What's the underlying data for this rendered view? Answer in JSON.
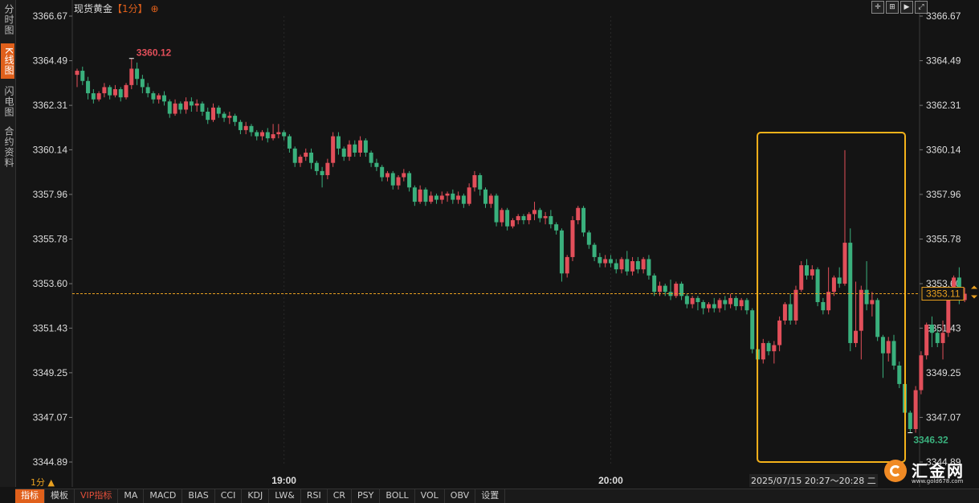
{
  "sidebar": {
    "tabs": [
      {
        "label": "分时图",
        "active": false
      },
      {
        "label": "K线图",
        "active": true
      },
      {
        "label": "闪电图",
        "active": false
      },
      {
        "label": "合约资料",
        "active": false
      }
    ]
  },
  "header": {
    "title": "现货黄金",
    "period": "【1分】",
    "add_symbol": "⊕"
  },
  "toolbar_icons": [
    "crosshair-icon",
    "zoom-icon",
    "play-icon",
    "fit-icon"
  ],
  "period_label": "1分 ▲",
  "range_label": "2025/07/15 20:27～20:28 二",
  "bottom_tabs": [
    {
      "label": "指标",
      "active": true
    },
    {
      "label": "模板"
    },
    {
      "label": "VIP指标",
      "vip": true
    },
    {
      "label": "MA"
    },
    {
      "label": "MACD"
    },
    {
      "label": "BIAS"
    },
    {
      "label": "CCI"
    },
    {
      "label": "KDJ"
    },
    {
      "label": "LW&"
    },
    {
      "label": "RSI"
    },
    {
      "label": "CR"
    },
    {
      "label": "PSY"
    },
    {
      "label": "BOLL"
    },
    {
      "label": "VOL"
    },
    {
      "label": "OBV"
    },
    {
      "label": "设置"
    }
  ],
  "logo": {
    "name": "汇金网",
    "url": "www.gold678.com"
  },
  "colors": {
    "up": "#e24f5a",
    "down": "#3ab07d",
    "accent": "#e0601b",
    "highlight": "#f5b21a",
    "background": "#141414"
  },
  "chart_data": {
    "type": "candlestick",
    "y_ticks": [
      3366.67,
      3364.49,
      3362.31,
      3360.14,
      3357.96,
      3355.78,
      3353.6,
      3351.43,
      3349.25,
      3347.07,
      3344.89
    ],
    "y_tick_labels": [
      "3366.67",
      "3364.49",
      "3362.31",
      "3360.14",
      "3357.96",
      "3355.78",
      "3353.60",
      "3351.43",
      "3349.25",
      "3347.07",
      "3344.89"
    ],
    "ylim": [
      3344.89,
      3366.67
    ],
    "x_tick_labels": [
      {
        "label": "19:00",
        "index": 38
      },
      {
        "label": "20:00",
        "index": 98
      }
    ],
    "current_price": 3353.11,
    "current_price_label": "3353.11",
    "high_label": "3360.12",
    "low_label": "3346.32",
    "highlight_range": [
      127,
      150
    ],
    "candles": [
      [
        3363.8,
        3364.0,
        3363.2,
        3364.1
      ],
      [
        3364.0,
        3363.5,
        3363.3,
        3364.2
      ],
      [
        3363.5,
        3362.9,
        3362.6,
        3363.7
      ],
      [
        3362.9,
        3362.6,
        3362.4,
        3363.1
      ],
      [
        3362.6,
        3362.9,
        3362.5,
        3363.0
      ],
      [
        3362.9,
        3363.2,
        3362.7,
        3363.4
      ],
      [
        3363.2,
        3362.8,
        3362.6,
        3363.3
      ],
      [
        3362.8,
        3363.1,
        3362.7,
        3363.3
      ],
      [
        3363.1,
        3362.7,
        3362.5,
        3363.2
      ],
      [
        3362.7,
        3363.3,
        3362.6,
        3363.4
      ],
      [
        3363.3,
        3364.1,
        3363.1,
        3364.6
      ],
      [
        3364.1,
        3363.6,
        3363.3,
        3364.4
      ],
      [
        3363.6,
        3363.2,
        3362.9,
        3363.8
      ],
      [
        3363.2,
        3362.9,
        3362.7,
        3363.4
      ],
      [
        3362.9,
        3362.6,
        3362.4,
        3363.0
      ],
      [
        3362.6,
        3362.8,
        3362.4,
        3362.9
      ],
      [
        3362.8,
        3362.5,
        3362.3,
        3363.0
      ],
      [
        3362.5,
        3361.9,
        3361.7,
        3362.6
      ],
      [
        3361.9,
        3362.4,
        3361.8,
        3362.6
      ],
      [
        3362.4,
        3362.1,
        3361.9,
        3362.5
      ],
      [
        3362.1,
        3362.5,
        3361.9,
        3362.7
      ],
      [
        3362.5,
        3362.3,
        3362.0,
        3362.7
      ],
      [
        3362.3,
        3362.4,
        3362.0,
        3362.6
      ],
      [
        3362.4,
        3362.0,
        3361.8,
        3362.5
      ],
      [
        3362.0,
        3361.6,
        3361.4,
        3362.2
      ],
      [
        3361.6,
        3362.2,
        3361.5,
        3362.4
      ],
      [
        3362.2,
        3361.9,
        3361.7,
        3362.3
      ],
      [
        3361.9,
        3361.7,
        3361.5,
        3362.0
      ],
      [
        3361.7,
        3361.8,
        3361.4,
        3362.0
      ],
      [
        3361.8,
        3361.5,
        3361.3,
        3361.9
      ],
      [
        3361.5,
        3361.1,
        3360.9,
        3361.6
      ],
      [
        3361.1,
        3361.3,
        3360.9,
        3361.5
      ],
      [
        3361.3,
        3361.0,
        3360.8,
        3361.4
      ],
      [
        3361.0,
        3360.8,
        3360.6,
        3361.1
      ],
      [
        3360.8,
        3361.0,
        3360.6,
        3361.1
      ],
      [
        3361.0,
        3360.7,
        3360.5,
        3361.2
      ],
      [
        3360.7,
        3360.9,
        3360.6,
        3361.4
      ],
      [
        3360.9,
        3361.0,
        3360.7,
        3361.4
      ],
      [
        3361.0,
        3360.8,
        3360.6,
        3361.1
      ],
      [
        3360.8,
        3360.2,
        3360.0,
        3360.9
      ],
      [
        3360.2,
        3359.5,
        3359.3,
        3360.3
      ],
      [
        3359.5,
        3359.8,
        3359.3,
        3359.9
      ],
      [
        3359.8,
        3360.0,
        3359.6,
        3360.2
      ],
      [
        3360.0,
        3359.5,
        3359.2,
        3360.2
      ],
      [
        3359.5,
        3359.1,
        3358.9,
        3359.6
      ],
      [
        3359.1,
        3358.9,
        3358.3,
        3359.3
      ],
      [
        3358.9,
        3359.5,
        3358.7,
        3359.7
      ],
      [
        3359.5,
        3360.8,
        3359.3,
        3361.0
      ],
      [
        3360.8,
        3360.2,
        3359.9,
        3361.0
      ],
      [
        3360.2,
        3359.8,
        3359.6,
        3360.3
      ],
      [
        3359.8,
        3360.4,
        3359.6,
        3360.6
      ],
      [
        3360.4,
        3360.0,
        3359.8,
        3360.6
      ],
      [
        3360.0,
        3360.6,
        3359.8,
        3360.8
      ],
      [
        3360.6,
        3360.0,
        3359.8,
        3360.7
      ],
      [
        3360.0,
        3359.5,
        3359.3,
        3360.1
      ],
      [
        3359.5,
        3359.3,
        3359.1,
        3359.7
      ],
      [
        3359.3,
        3358.8,
        3358.6,
        3359.4
      ],
      [
        3358.8,
        3359.0,
        3358.6,
        3359.1
      ],
      [
        3359.0,
        3358.4,
        3358.2,
        3359.1
      ],
      [
        3358.4,
        3358.8,
        3358.2,
        3358.9
      ],
      [
        3358.8,
        3359.0,
        3358.6,
        3359.2
      ],
      [
        3359.0,
        3358.3,
        3358.1,
        3359.1
      ],
      [
        3358.3,
        3357.6,
        3357.4,
        3358.4
      ],
      [
        3357.6,
        3358.2,
        3357.5,
        3358.4
      ],
      [
        3358.2,
        3357.6,
        3357.4,
        3358.3
      ],
      [
        3357.6,
        3357.9,
        3357.5,
        3358.1
      ],
      [
        3357.9,
        3357.7,
        3357.5,
        3358.0
      ],
      [
        3357.7,
        3357.9,
        3357.5,
        3358.1
      ],
      [
        3357.9,
        3358.0,
        3357.6,
        3358.1
      ],
      [
        3358.0,
        3357.7,
        3357.5,
        3358.2
      ],
      [
        3357.7,
        3357.9,
        3357.5,
        3358.1
      ],
      [
        3357.9,
        3357.5,
        3357.3,
        3358.0
      ],
      [
        3357.5,
        3358.3,
        3357.4,
        3358.5
      ],
      [
        3358.3,
        3358.9,
        3358.1,
        3359.1
      ],
      [
        3358.9,
        3358.2,
        3357.9,
        3359.0
      ],
      [
        3358.2,
        3357.5,
        3357.3,
        3358.3
      ],
      [
        3357.5,
        3357.9,
        3357.3,
        3358.0
      ],
      [
        3357.9,
        3356.6,
        3356.4,
        3358.0
      ],
      [
        3356.6,
        3357.2,
        3356.4,
        3357.3
      ],
      [
        3357.2,
        3356.4,
        3356.2,
        3357.3
      ],
      [
        3356.4,
        3356.7,
        3356.3,
        3356.8
      ],
      [
        3356.7,
        3356.9,
        3356.5,
        3357.0
      ],
      [
        3356.9,
        3356.7,
        3356.5,
        3357.0
      ],
      [
        3356.7,
        3357.0,
        3356.5,
        3357.1
      ],
      [
        3357.0,
        3357.2,
        3356.7,
        3357.6
      ],
      [
        3357.2,
        3356.8,
        3356.6,
        3357.3
      ],
      [
        3356.8,
        3356.9,
        3356.5,
        3357.1
      ],
      [
        3356.9,
        3356.5,
        3356.3,
        3357.2
      ],
      [
        3356.5,
        3356.2,
        3356.0,
        3356.6
      ],
      [
        3356.2,
        3354.1,
        3353.7,
        3356.3
      ],
      [
        3354.1,
        3354.9,
        3353.9,
        3355.0
      ],
      [
        3354.9,
        3356.7,
        3354.7,
        3356.9
      ],
      [
        3356.7,
        3357.3,
        3356.5,
        3357.4
      ],
      [
        3357.3,
        3356.1,
        3355.9,
        3357.4
      ],
      [
        3356.1,
        3355.5,
        3355.3,
        3356.2
      ],
      [
        3355.5,
        3354.9,
        3354.7,
        3355.6
      ],
      [
        3354.9,
        3354.6,
        3354.4,
        3355.1
      ],
      [
        3354.6,
        3354.8,
        3354.4,
        3355.0
      ],
      [
        3354.8,
        3354.6,
        3354.4,
        3355.0
      ],
      [
        3354.6,
        3354.3,
        3354.1,
        3354.8
      ],
      [
        3354.3,
        3354.8,
        3354.1,
        3354.9
      ],
      [
        3354.8,
        3354.2,
        3354.0,
        3355.2
      ],
      [
        3354.2,
        3354.7,
        3354.0,
        3354.9
      ],
      [
        3354.7,
        3354.3,
        3354.1,
        3354.9
      ],
      [
        3354.3,
        3354.8,
        3354.1,
        3354.9
      ],
      [
        3354.8,
        3354.0,
        3353.8,
        3355.0
      ],
      [
        3354.0,
        3353.2,
        3353.0,
        3354.1
      ],
      [
        3353.2,
        3353.5,
        3353.0,
        3353.7
      ],
      [
        3353.5,
        3353.2,
        3353.0,
        3353.6
      ],
      [
        3353.2,
        3353.0,
        3352.8,
        3353.8
      ],
      [
        3353.0,
        3353.6,
        3352.9,
        3353.7
      ],
      [
        3353.6,
        3353.0,
        3352.8,
        3353.7
      ],
      [
        3353.0,
        3352.6,
        3352.4,
        3353.1
      ],
      [
        3352.6,
        3352.9,
        3352.4,
        3353.0
      ],
      [
        3352.9,
        3352.7,
        3352.3,
        3353.0
      ],
      [
        3352.7,
        3352.4,
        3352.1,
        3352.8
      ],
      [
        3352.4,
        3352.6,
        3352.2,
        3352.7
      ],
      [
        3352.6,
        3352.4,
        3352.2,
        3352.9
      ],
      [
        3352.4,
        3352.8,
        3352.2,
        3352.9
      ],
      [
        3352.8,
        3352.6,
        3352.3,
        3353.0
      ],
      [
        3352.6,
        3352.9,
        3352.4,
        3353.1
      ],
      [
        3352.9,
        3352.5,
        3352.3,
        3353.0
      ],
      [
        3352.5,
        3352.8,
        3352.3,
        3352.9
      ],
      [
        3352.8,
        3352.3,
        3352.1,
        3352.9
      ],
      [
        3352.3,
        3350.4,
        3350.2,
        3352.4
      ],
      [
        3350.4,
        3349.9,
        3349.4,
        3350.6
      ],
      [
        3349.9,
        3350.7,
        3349.7,
        3350.9
      ],
      [
        3350.7,
        3350.3,
        3350.1,
        3350.8
      ],
      [
        3350.3,
        3350.6,
        3349.7,
        3350.8
      ],
      [
        3350.6,
        3351.8,
        3350.3,
        3352.0
      ],
      [
        3351.8,
        3352.6,
        3351.6,
        3352.7
      ],
      [
        3352.6,
        3351.8,
        3351.6,
        3353.1
      ],
      [
        3351.8,
        3353.3,
        3351.6,
        3353.5
      ],
      [
        3353.3,
        3354.5,
        3353.2,
        3354.7
      ],
      [
        3354.5,
        3354.0,
        3353.8,
        3354.8
      ],
      [
        3354.0,
        3354.3,
        3353.8,
        3354.5
      ],
      [
        3354.3,
        3352.7,
        3352.5,
        3354.4
      ],
      [
        3352.7,
        3352.3,
        3352.1,
        3352.9
      ],
      [
        3352.3,
        3353.2,
        3352.1,
        3354.4
      ],
      [
        3353.2,
        3353.9,
        3353.0,
        3354.0
      ],
      [
        3353.9,
        3353.6,
        3353.4,
        3354.4
      ],
      [
        3353.6,
        3355.6,
        3353.5,
        3360.12
      ],
      [
        3355.6,
        3350.7,
        3350.3,
        3356.3
      ],
      [
        3350.7,
        3351.3,
        3350.5,
        3353.7
      ],
      [
        3351.3,
        3353.3,
        3349.9,
        3353.5
      ],
      [
        3353.3,
        3352.6,
        3352.3,
        3354.7
      ],
      [
        3352.6,
        3352.8,
        3352.0,
        3353.2
      ],
      [
        3352.8,
        3351.0,
        3350.8,
        3352.9
      ],
      [
        3351.0,
        3350.2,
        3349.0,
        3351.1
      ],
      [
        3350.2,
        3350.8,
        3349.8,
        3351.0
      ],
      [
        3350.8,
        3349.6,
        3349.4,
        3351.1
      ],
      [
        3349.6,
        3348.7,
        3348.5,
        3349.8
      ],
      [
        3348.7,
        3347.3,
        3347.0,
        3348.8
      ],
      [
        3347.3,
        3346.5,
        3346.32,
        3347.4
      ],
      [
        3346.5,
        3348.4,
        3346.32,
        3348.6
      ],
      [
        3348.4,
        3350.1,
        3348.2,
        3350.3
      ],
      [
        3350.1,
        3351.6,
        3349.9,
        3351.7
      ],
      [
        3351.6,
        3351.2,
        3350.5,
        3352.0
      ],
      [
        3351.2,
        3350.7,
        3350.5,
        3351.4
      ],
      [
        3350.7,
        3351.2,
        3349.9,
        3351.8
      ],
      [
        3351.2,
        3353.1,
        3351.0,
        3353.4
      ],
      [
        3353.1,
        3353.9,
        3352.9,
        3354.0
      ],
      [
        3353.9,
        3352.8,
        3352.6,
        3354.4
      ],
      [
        3352.8,
        3353.11,
        3352.7,
        3353.4
      ]
    ]
  }
}
